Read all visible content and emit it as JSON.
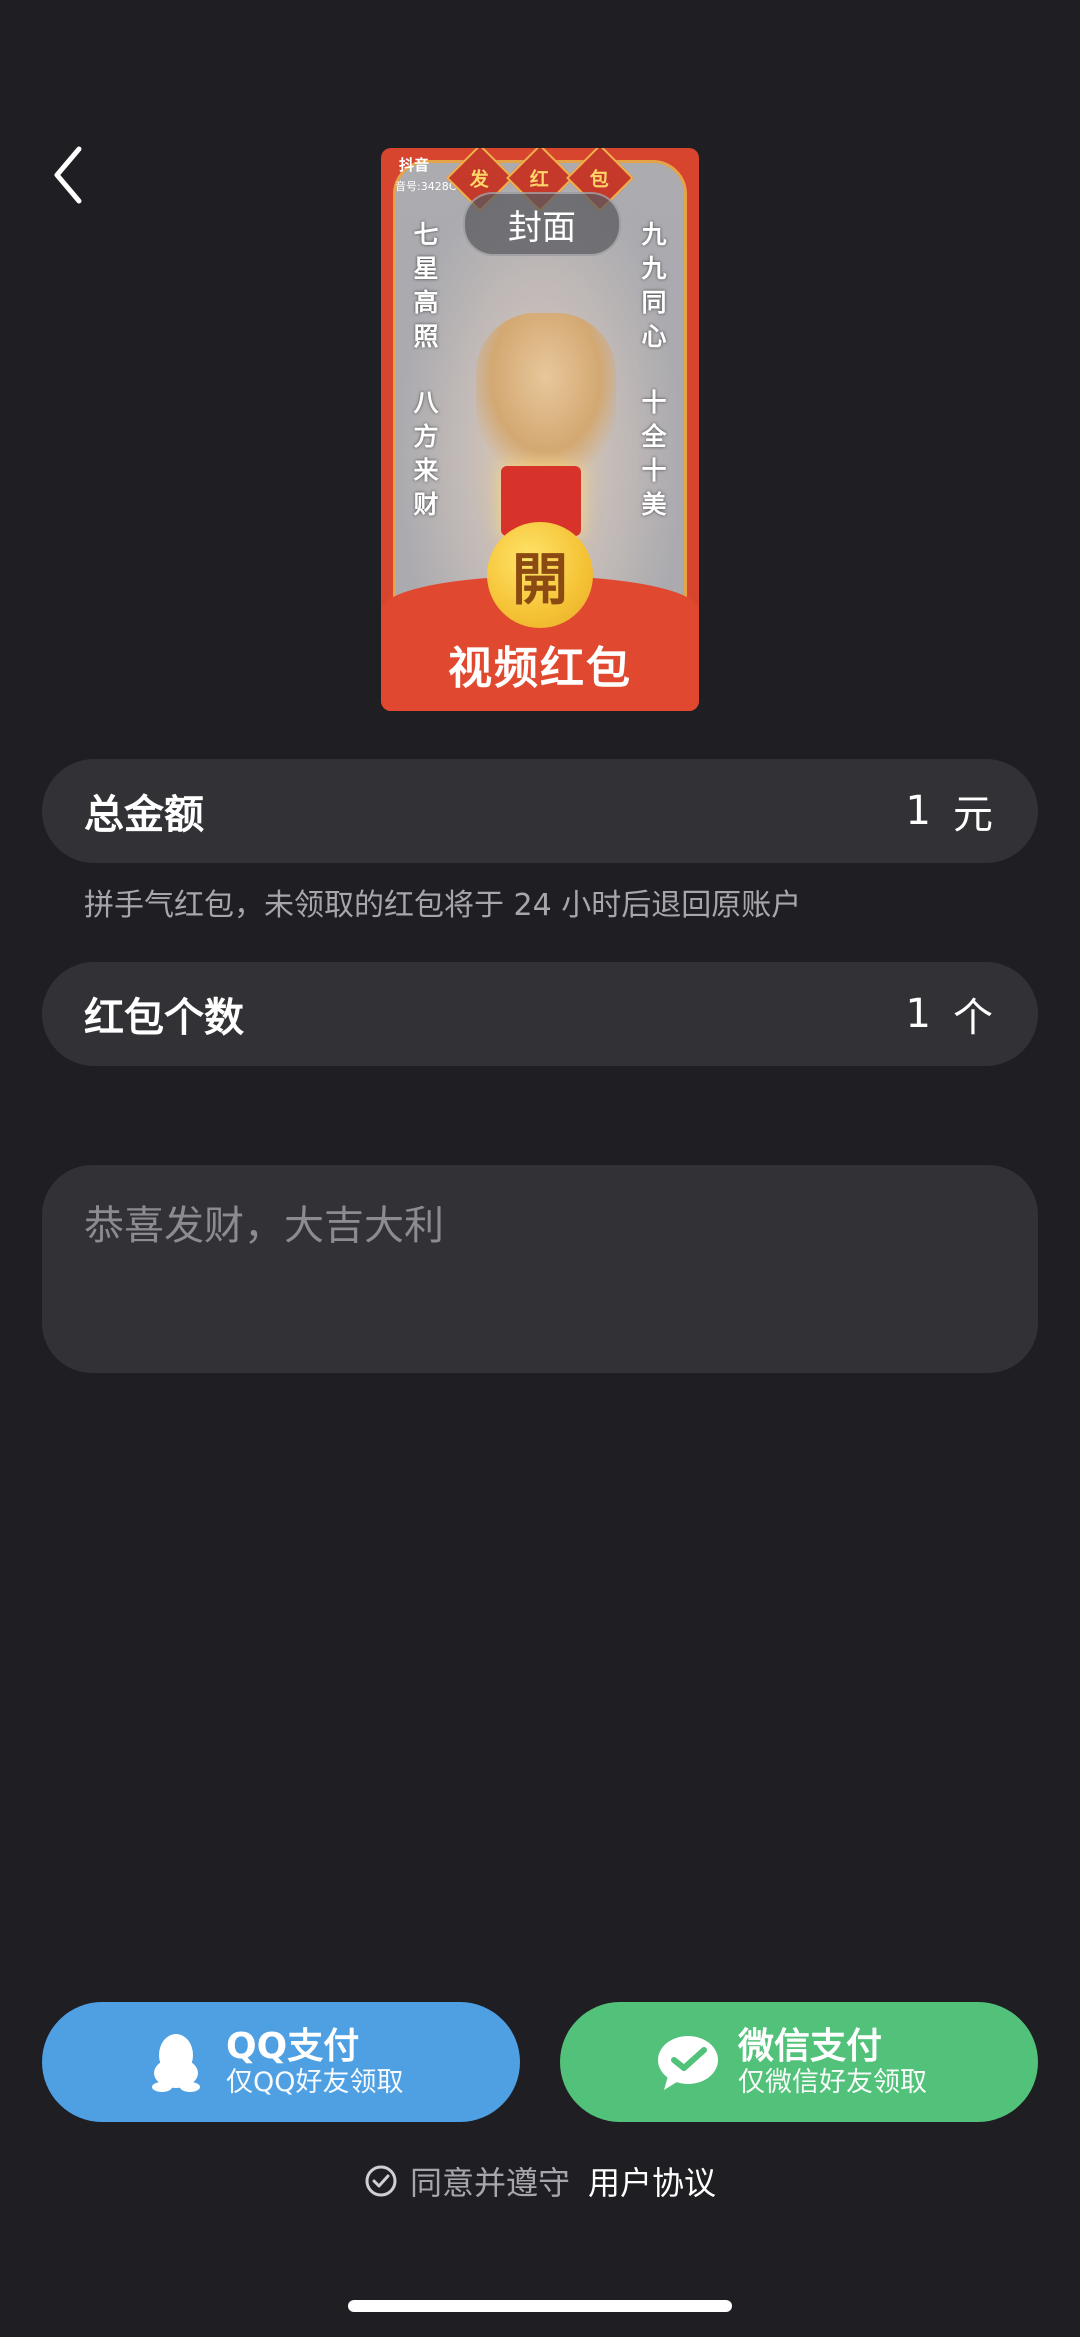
{
  "nav": {
    "back_icon": "chevron-left-icon"
  },
  "cover": {
    "app_label": "抖音",
    "uid_label": "音号:3428C",
    "badge_chars": [
      "发",
      "红",
      "包"
    ],
    "cover_button_label": "封面",
    "couplet_left_top": "七星高照",
    "couplet_left_bottom": "八方来财",
    "couplet_right_top": "九九同心",
    "couplet_right_bottom": "十全十美",
    "open_char": "開",
    "caption": "视频红包"
  },
  "amount": {
    "label": "总金额",
    "value": "1",
    "unit": "元"
  },
  "hint": "拼手气红包，未领取的红包将于 24 小时后退回原账户",
  "count": {
    "label": "红包个数",
    "value": "1",
    "unit": "个"
  },
  "message": {
    "placeholder": "恭喜发财，大吉大利"
  },
  "pay": {
    "qq": {
      "label": "QQ支付",
      "sub": "仅QQ好友领取",
      "color": "#4fa0e3",
      "icon": "qq-penguin-icon"
    },
    "wechat": {
      "label": "微信支付",
      "sub": "仅微信好友领取",
      "color": "#52c27a",
      "icon": "wechat-icon"
    }
  },
  "agreement": {
    "text": "同意并遵守",
    "link": "用户协议"
  },
  "colors": {
    "background": "#1e1e23",
    "row_background": "#323236",
    "cover_red": "#d8452f"
  }
}
